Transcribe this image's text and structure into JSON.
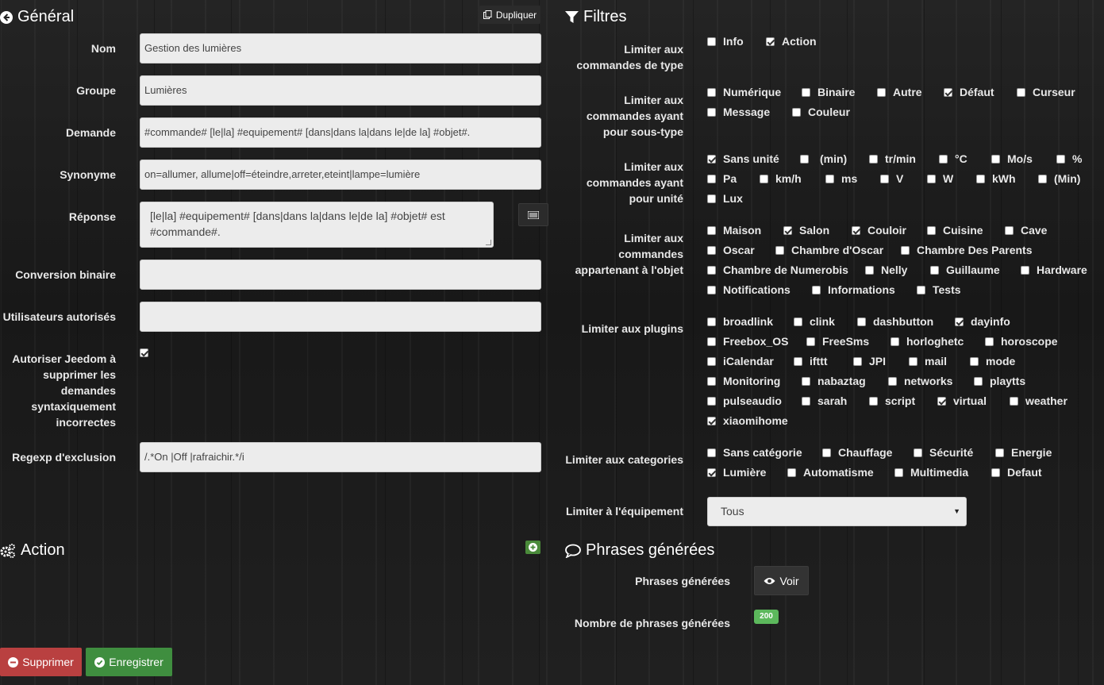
{
  "general": {
    "title": "Général",
    "duplicate_label": "Dupliquer",
    "fields": {
      "nom": {
        "label": "Nom",
        "value": "Gestion des lumières"
      },
      "groupe": {
        "label": "Groupe",
        "value": "Lumières"
      },
      "demande": {
        "label": "Demande",
        "value": "#commande# [le|la] #equipement# [dans|dans la|dans le|de la] #objet#."
      },
      "synonyme": {
        "label": "Synonyme",
        "value": "on=allumer, allume|off=éteindre,arreter,eteint|lampe=lumière"
      },
      "reponse": {
        "label": "Réponse",
        "value": "[le|la] #equipement# [dans|dans la|dans le|de la] #objet# est #commande#."
      },
      "conversion": {
        "label": "Conversion binaire",
        "value": ""
      },
      "utilisateurs": {
        "label": "Utilisateurs autorisés",
        "value": ""
      },
      "autoriser": {
        "label": "Autoriser Jeedom à supprimer les demandes syntaxiquement incorrectes",
        "checked": true
      },
      "regexp": {
        "label": "Regexp d'exclusion",
        "value": "/.*On |Off |rafraichir.*/i"
      }
    }
  },
  "action": {
    "title": "Action"
  },
  "buttons": {
    "delete": "Supprimer",
    "save": "Enregistrer"
  },
  "filtres": {
    "title": "Filtres",
    "type": {
      "label": "Limiter aux commandes de type",
      "options": [
        {
          "label": "Info",
          "checked": false
        },
        {
          "label": "Action",
          "checked": true
        }
      ]
    },
    "subtype": {
      "label": "Limiter aux commandes ayant pour sous-type",
      "options": [
        {
          "label": "Numérique",
          "checked": false
        },
        {
          "label": "Binaire",
          "checked": false
        },
        {
          "label": "Autre",
          "checked": false
        },
        {
          "label": "Défaut",
          "checked": true
        },
        {
          "label": "Curseur",
          "checked": false
        },
        {
          "label": "Message",
          "checked": false
        },
        {
          "label": "Couleur",
          "checked": false
        }
      ]
    },
    "unit": {
      "label": "Limiter aux commandes ayant pour unité",
      "options": [
        {
          "label": "Sans unité",
          "checked": true
        },
        {
          "label": "(min)",
          "checked": false
        },
        {
          "label": "tr/min",
          "checked": false
        },
        {
          "label": "°C",
          "checked": false
        },
        {
          "label": "Mo/s",
          "checked": false
        },
        {
          "label": "%",
          "checked": false
        },
        {
          "label": "Pa",
          "checked": false
        },
        {
          "label": "km/h",
          "checked": false
        },
        {
          "label": "ms",
          "checked": false
        },
        {
          "label": "V",
          "checked": false
        },
        {
          "label": "W",
          "checked": false
        },
        {
          "label": "kWh",
          "checked": false
        },
        {
          "label": "(Min)",
          "checked": false
        },
        {
          "label": "Lux",
          "checked": false
        }
      ]
    },
    "object": {
      "label": "Limiter aux commandes appartenant à l'objet",
      "options": [
        {
          "label": "Maison",
          "checked": false
        },
        {
          "label": "Salon",
          "checked": true
        },
        {
          "label": "Couloir",
          "checked": true
        },
        {
          "label": "Cuisine",
          "checked": false
        },
        {
          "label": "Cave",
          "checked": false
        },
        {
          "label": "Oscar",
          "checked": false
        },
        {
          "label": "Chambre d'Oscar",
          "checked": false
        },
        {
          "label": "Chambre Des Parents",
          "checked": false
        },
        {
          "label": "Chambre de Numerobis",
          "checked": false
        },
        {
          "label": "Nelly",
          "checked": false
        },
        {
          "label": "Guillaume",
          "checked": false
        },
        {
          "label": "Hardware",
          "checked": false
        },
        {
          "label": "Notifications",
          "checked": false
        },
        {
          "label": "Informations",
          "checked": false
        },
        {
          "label": "Tests",
          "checked": false
        }
      ]
    },
    "plugins": {
      "label": "Limiter aux plugins",
      "options": [
        {
          "label": "broadlink",
          "checked": false
        },
        {
          "label": "clink",
          "checked": false
        },
        {
          "label": "dashbutton",
          "checked": false
        },
        {
          "label": "dayinfo",
          "checked": true
        },
        {
          "label": "Freebox_OS",
          "checked": false
        },
        {
          "label": "FreeSms",
          "checked": false
        },
        {
          "label": "horloghetc",
          "checked": false
        },
        {
          "label": "horoscope",
          "checked": false
        },
        {
          "label": "iCalendar",
          "checked": false
        },
        {
          "label": "ifttt",
          "checked": false
        },
        {
          "label": "JPI",
          "checked": false
        },
        {
          "label": "mail",
          "checked": false
        },
        {
          "label": "mode",
          "checked": false
        },
        {
          "label": "Monitoring",
          "checked": false
        },
        {
          "label": "nabaztag",
          "checked": false
        },
        {
          "label": "networks",
          "checked": false
        },
        {
          "label": "playtts",
          "checked": false
        },
        {
          "label": "pulseaudio",
          "checked": false
        },
        {
          "label": "sarah",
          "checked": false
        },
        {
          "label": "script",
          "checked": false
        },
        {
          "label": "virtual",
          "checked": true
        },
        {
          "label": "weather",
          "checked": false
        },
        {
          "label": "xiaomihome",
          "checked": true
        }
      ]
    },
    "categories": {
      "label": "Limiter aux categories",
      "options": [
        {
          "label": "Sans catégorie",
          "checked": false
        },
        {
          "label": "Chauffage",
          "checked": false
        },
        {
          "label": "Sécurité",
          "checked": false
        },
        {
          "label": "Energie",
          "checked": false
        },
        {
          "label": "Lumière",
          "checked": true
        },
        {
          "label": "Automatisme",
          "checked": false
        },
        {
          "label": "Multimedia",
          "checked": false
        },
        {
          "label": "Defaut",
          "checked": false
        }
      ]
    },
    "equipment": {
      "label": "Limiter à l'équipement",
      "value": "Tous"
    }
  },
  "phrases": {
    "title": "Phrases générées",
    "label": "Phrases générées",
    "view_label": "Voir",
    "count_label": "Nombre de phrases générées",
    "count": "200"
  }
}
